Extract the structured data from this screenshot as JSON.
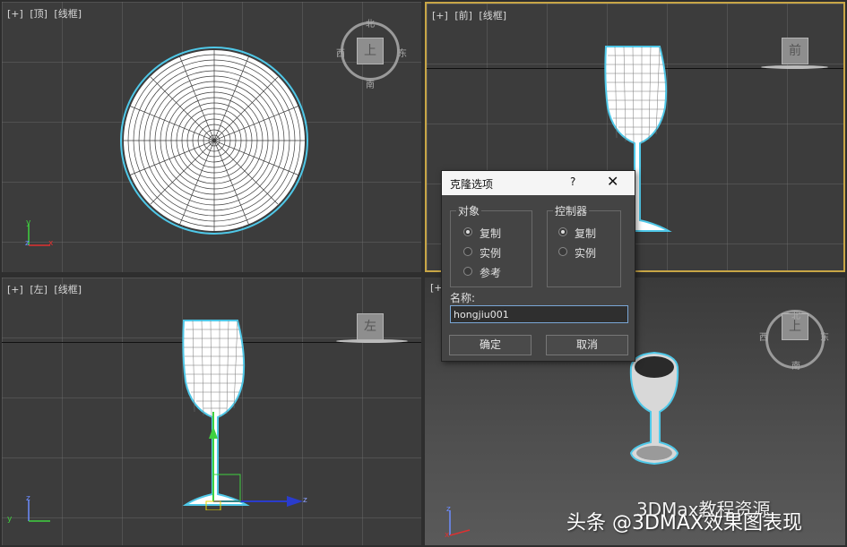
{
  "viewports": {
    "top": {
      "plus": "[+]",
      "view": "[顶]",
      "mode": "[线框]",
      "cube_label": "上",
      "compass": {
        "n": "北",
        "s": "南",
        "e": "东",
        "w": "西"
      },
      "axis_y": "y",
      "axis_x": "x",
      "axis_z": "z"
    },
    "front": {
      "plus": "[+]",
      "view": "[前]",
      "mode": "[线框]",
      "cube_label": "前"
    },
    "left": {
      "plus": "[+]",
      "view": "[左]",
      "mode": "[线框]",
      "cube_label": "左",
      "axis_z": "z",
      "axis_y": "y",
      "gizmo_z": "z"
    },
    "persp": {
      "plus": "[+",
      "cube_label": "上",
      "compass": {
        "w": "西",
        "s": "南",
        "e": "东",
        "n": "北"
      },
      "axis_z": "z",
      "axis_x": "x"
    }
  },
  "dialog": {
    "title": "克隆选项",
    "help": "?",
    "close": "✕",
    "object_group": {
      "label": "对象",
      "options": [
        "复制",
        "实例",
        "参考"
      ],
      "selected": 0
    },
    "controller_group": {
      "label": "控制器",
      "options": [
        "复制",
        "实例"
      ],
      "selected": 0
    },
    "name_label": "名称:",
    "name_value": "hongjiu001",
    "ok": "确定",
    "cancel": "取消"
  },
  "watermark": {
    "channel": "3DMax教程资源",
    "source": "头条 @3DMAX效果图表现"
  },
  "colors": {
    "active_border": "#c8a646",
    "selection_cyan": "#4fc8e8",
    "wireframe": "#ffffff"
  }
}
